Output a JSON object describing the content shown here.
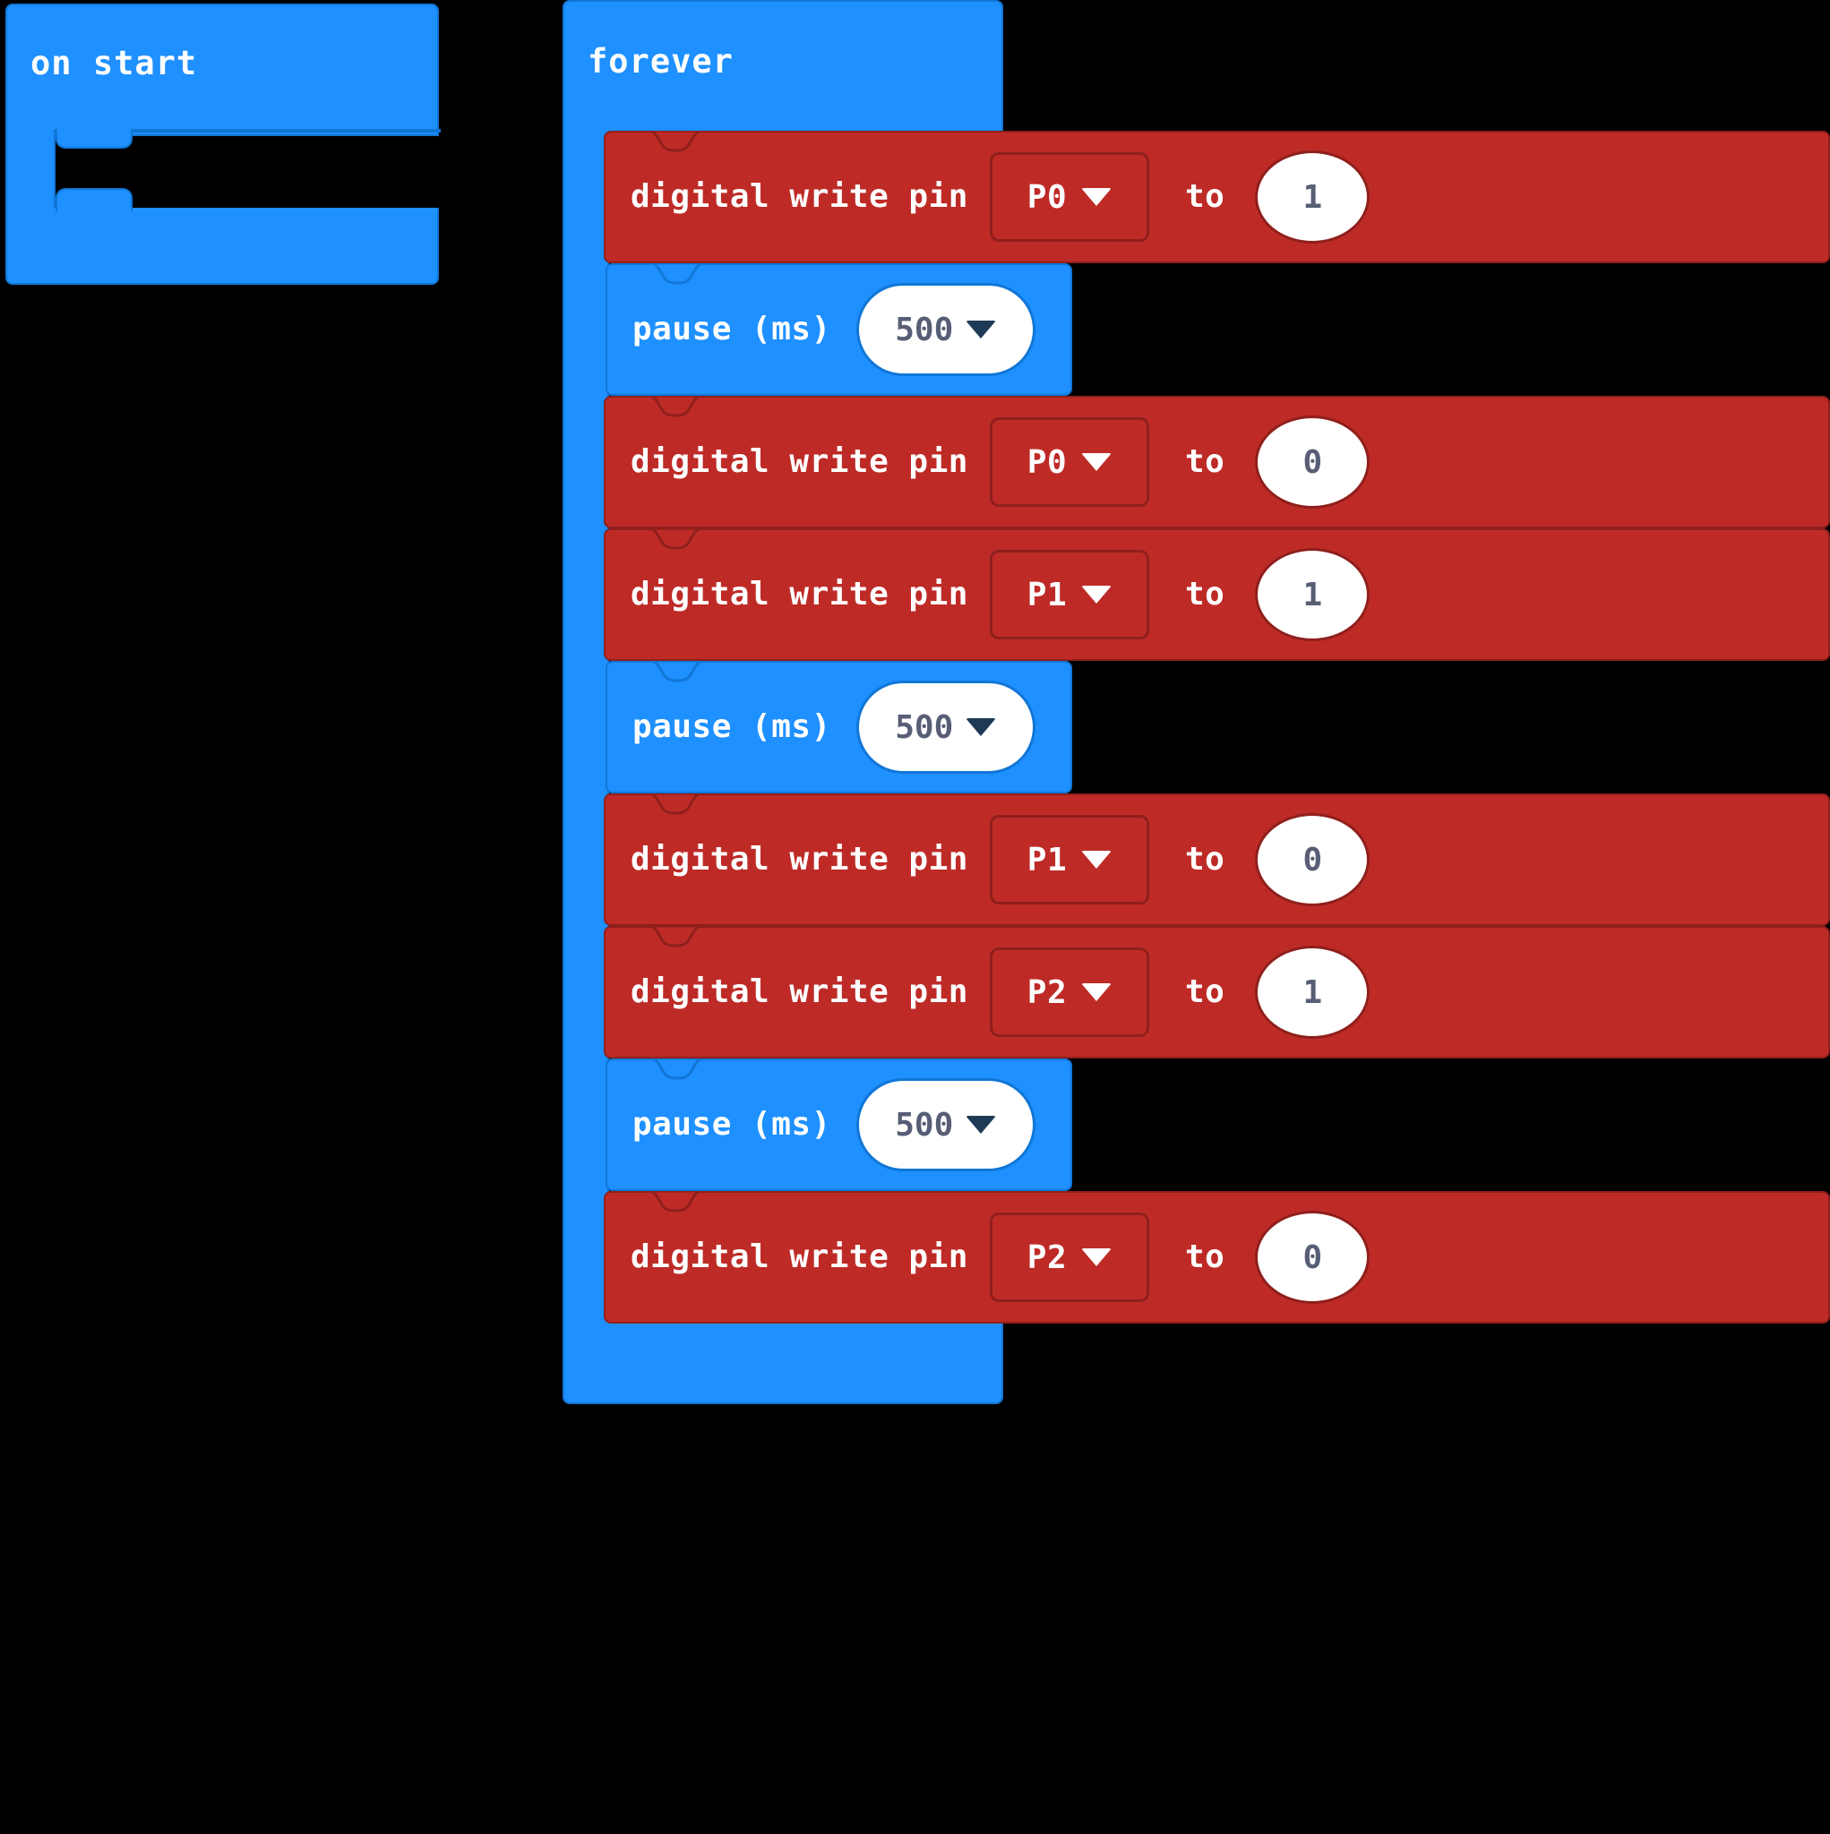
{
  "workspace": {
    "background_color": "#000000",
    "block_blue": "#1E90FF",
    "block_blue_border": "#1176D6",
    "block_red": "#BE2B27",
    "block_red_border": "#8F1F1C",
    "value_text_color": "#575E75",
    "label_text_color": "#FFFFFF"
  },
  "on_start": {
    "label": "on start",
    "body_blocks": []
  },
  "forever": {
    "label": "forever",
    "body": [
      {
        "kind": "digital-write-pin",
        "color": "red",
        "label": "digital write pin",
        "pin": "P0",
        "to_label": "to",
        "value": "1"
      },
      {
        "kind": "pause",
        "color": "blue",
        "label": "pause (ms)",
        "value": "500"
      },
      {
        "kind": "digital-write-pin",
        "color": "red",
        "label": "digital write pin",
        "pin": "P0",
        "to_label": "to",
        "value": "0"
      },
      {
        "kind": "digital-write-pin",
        "color": "red",
        "label": "digital write pin",
        "pin": "P1",
        "to_label": "to",
        "value": "1"
      },
      {
        "kind": "pause",
        "color": "blue",
        "label": "pause (ms)",
        "value": "500"
      },
      {
        "kind": "digital-write-pin",
        "color": "red",
        "label": "digital write pin",
        "pin": "P1",
        "to_label": "to",
        "value": "0"
      },
      {
        "kind": "digital-write-pin",
        "color": "red",
        "label": "digital write pin",
        "pin": "P2",
        "to_label": "to",
        "value": "1"
      },
      {
        "kind": "pause",
        "color": "blue",
        "label": "pause (ms)",
        "value": "500"
      },
      {
        "kind": "digital-write-pin",
        "color": "red",
        "label": "digital write pin",
        "pin": "P2",
        "to_label": "to",
        "value": "0"
      }
    ]
  },
  "icons": {
    "dropdown_arrow": "chevron-down-icon"
  }
}
